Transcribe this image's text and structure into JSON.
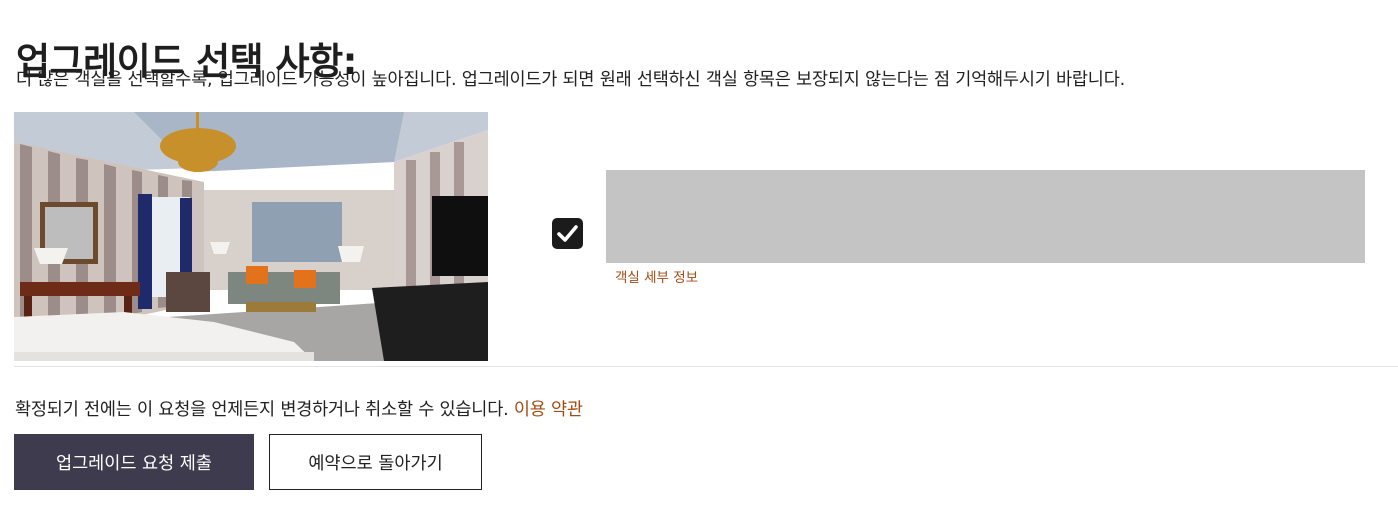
{
  "page": {
    "title": "업그레이드 선택 사항:",
    "subtitle": "더 많은 객실을 선택할수록, 업그레이드 가능성이 높아집니다. 업그레이드가 되면 원래 선택하신 객실 항목은 보장되지 않는다는 점 기억해두시기 바랍니다."
  },
  "room_option": {
    "image_icon": "hotel-room-photo",
    "checked": true,
    "details_link": "객실 세부 정보"
  },
  "footer": {
    "notice": "확정되기 전에는 이 요청을 언제든지 변경하거나 취소할 수 있습니다.",
    "terms_link": "이용 약관",
    "submit_label": "업그레이드 요청 제출",
    "back_label": "예약으로 돌아가기"
  },
  "colors": {
    "accent_link": "#a34d16",
    "primary_button": "#3f3b4f",
    "placeholder": "#c4c4c4"
  }
}
